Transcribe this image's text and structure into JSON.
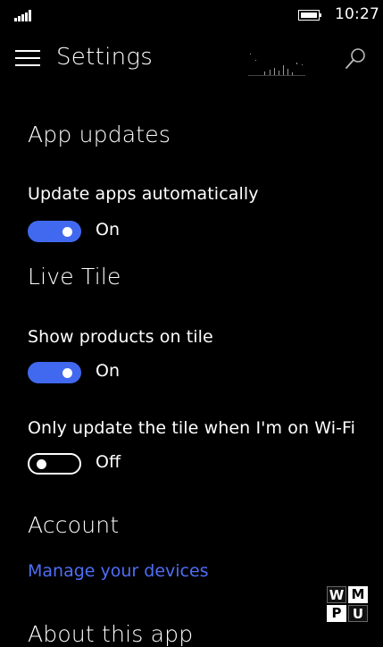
{
  "status_bar": {
    "time": "10:27"
  },
  "header": {
    "title": "Settings"
  },
  "app_updates": {
    "heading": "App updates",
    "update_automatically": {
      "label": "Update apps automatically",
      "state": "On"
    }
  },
  "live_tile": {
    "heading": "Live Tile",
    "show_products": {
      "label": "Show products on tile",
      "state": "On"
    },
    "wifi_only": {
      "label": "Only update the tile when I'm on Wi-Fi",
      "state": "Off"
    }
  },
  "account": {
    "heading": "Account",
    "manage_link": "Manage your devices"
  },
  "about": {
    "heading": "About this app"
  },
  "watermark": {
    "letters": [
      "W",
      "M",
      "P",
      "U"
    ]
  },
  "colors": {
    "accent": "#4169f0",
    "link": "#4f6ef5",
    "background": "#000000",
    "text": "#ffffff"
  }
}
